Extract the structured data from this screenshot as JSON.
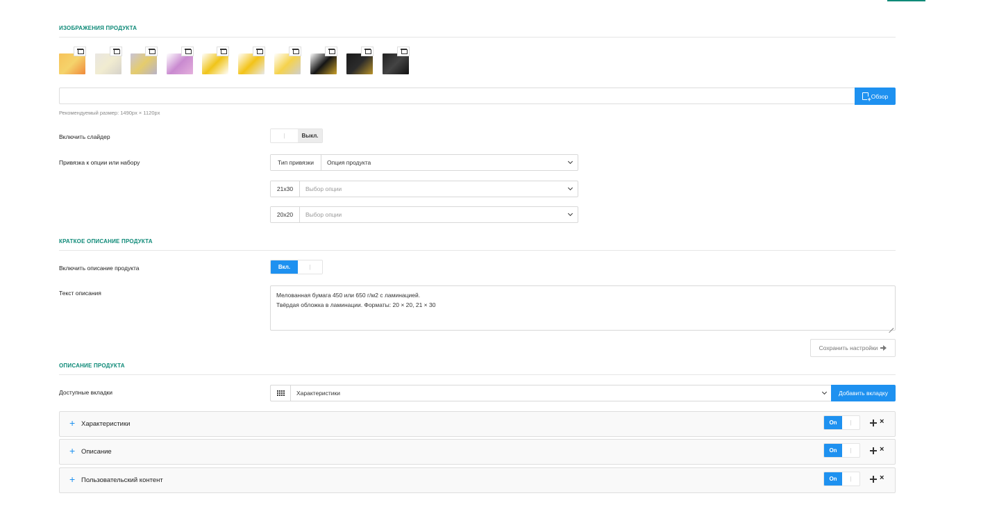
{
  "images_section": {
    "title": "ИЗОБРАЖЕНИЯ ПРОДУКТА",
    "thumbnails": [
      {
        "name": "thumb-1",
        "colors": [
          "#f7c35a",
          "#f5d36b",
          "#f0893a"
        ]
      },
      {
        "name": "thumb-2",
        "colors": [
          "#e9e6e2",
          "#f1ecd0",
          "#d6d2cb"
        ]
      },
      {
        "name": "thumb-3",
        "colors": [
          "#c9c4d6",
          "#e5cc6c",
          "#b8b3c8"
        ]
      },
      {
        "name": "thumb-4",
        "colors": [
          "#fff",
          "#c98ad0",
          "#e4b0dd"
        ]
      },
      {
        "name": "thumb-5",
        "colors": [
          "#fff",
          "#f0c419",
          "#fff"
        ]
      },
      {
        "name": "thumb-6",
        "colors": [
          "#fff",
          "#f3c318",
          "#e8e8e8"
        ]
      },
      {
        "name": "thumb-7",
        "colors": [
          "#fff",
          "#f5d24c",
          "#cfcfcf"
        ]
      },
      {
        "name": "thumb-8",
        "colors": [
          "#fff",
          "#151515",
          "#caa12a"
        ]
      },
      {
        "name": "thumb-9",
        "colors": [
          "#1a1a1a",
          "#2b2b2b",
          "#b8922a"
        ]
      },
      {
        "name": "thumb-10",
        "colors": [
          "#222",
          "#444",
          "#111"
        ]
      }
    ],
    "browse_label": "Обзор",
    "hint": "Рекомендуемый размер: 1490px × 1120px"
  },
  "slider": {
    "label": "Включить слайдер",
    "off_label": "Выкл.",
    "divider": "|"
  },
  "binding": {
    "label": "Привязка к опции или набору",
    "type_addon": "Тип привязки",
    "type_value": "Опция продукта",
    "rows": [
      {
        "addon": "21x30",
        "placeholder": "Выбор опции"
      },
      {
        "addon": "20x20",
        "placeholder": "Выбор опции"
      }
    ]
  },
  "short_desc_section": {
    "title": "КРАТКОЕ ОПИСАНИЕ ПРОДУКТА",
    "enable_label": "Включить описание продукта",
    "on_label": "Вкл.",
    "divider": "|",
    "text_label": "Текст описания",
    "text_line1": "Мелованная бумага 450 или 650 г/м2 с ламинацией.",
    "text_line2": "Твёрдая обложка в ламинации. Форматы: 20 × 20, 21 × 30",
    "save_label": "Сохранить настройки"
  },
  "description_section": {
    "title": "ОПИСАНИЕ ПРОДУКТА",
    "tabs_label": "Доступные вкладки",
    "tabs_value": "Характеристики",
    "add_tab_label": "Добавить вкладку",
    "panels": [
      {
        "title": "Характеристики",
        "on_label": "On",
        "divider": "|",
        "plus": "+",
        "close": "×"
      },
      {
        "title": "Описание",
        "on_label": "On",
        "divider": "|",
        "plus": "+",
        "close": "×"
      },
      {
        "title": "Пользовательский контент",
        "on_label": "On",
        "divider": "|",
        "plus": "+",
        "close": "×"
      }
    ]
  },
  "accent_color": "#0f8a78",
  "primary_color": "#1e91f0"
}
